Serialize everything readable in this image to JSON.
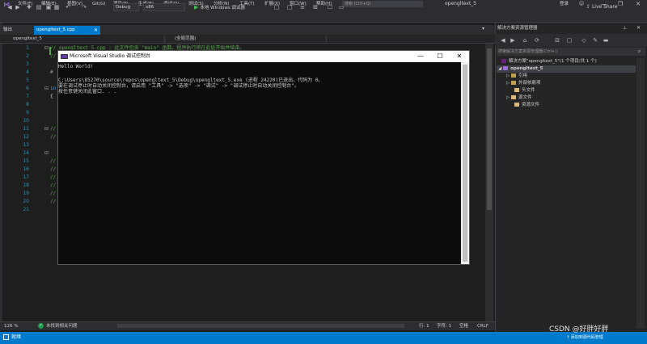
{
  "titlebar": {
    "menu": [
      "文件(F)",
      "编辑(E)",
      "视图(V)",
      "Git(G)",
      "项目(P)",
      "生成(B)",
      "调试(D)",
      "测试(S)",
      "分析(N)",
      "工具(T)",
      "扩展(X)",
      "窗口(W)",
      "帮助(H)"
    ],
    "search_placeholder": "搜索 (Ctrl+Q)",
    "window_title": "opengltext_5",
    "login": "登录",
    "minimize": "—",
    "restore": "❐",
    "close": "✕"
  },
  "toolbar": {
    "config": "Debug",
    "platform": "x86",
    "run_label": "本地 Windows 调试器",
    "liveshare": "Live Share"
  },
  "tabs": {
    "output": "输出",
    "file_tab": "opengltext_5.cpp",
    "file_tab_close": "✕"
  },
  "navbar": {
    "project": "opengltext_5",
    "scope": "(全局范围)"
  },
  "editor": {
    "line_numbers": [
      "1",
      "2",
      "3",
      "4",
      "5",
      "6",
      "7",
      "8",
      "9",
      "10",
      "11",
      "12",
      "13",
      "14",
      "15",
      "16",
      "17",
      "18",
      "19",
      "20",
      "21"
    ],
    "code_line1": "// opengltext_5.cpp : 此文件包含 \"main\" 函数。程序执行将在此处开始并结束。",
    "code_line2": "//",
    "code_line4": "#",
    "code_line6": "in",
    "code_line7": "{",
    "code_line11": "//",
    "code_line12": "//",
    "code_lines_14_20": [
      "//",
      "//",
      "//",
      "//",
      "//",
      "//",
      "//"
    ]
  },
  "editor_status": {
    "zoom": "126 %",
    "issues": "未找到相关问题",
    "line": "行: 1",
    "char": "字符: 1",
    "spaces": "空格",
    "eol": "CRLF"
  },
  "statusbar": {
    "ready": "就绪",
    "source_control": "添加到源代码管理"
  },
  "solution_explorer": {
    "title": "解决方案资源管理器",
    "search_placeholder": "搜索解决方案资源管理器(Ctrl+;)",
    "solution": "解决方案\"opengltext_5\"(1 个项目/共 1 个)",
    "project": "opengltext_5",
    "items": [
      "引用",
      "外部依赖项",
      "头文件",
      "源文件",
      "资源文件"
    ]
  },
  "console": {
    "title": "Microsoft Visual Studio 调试控制台",
    "lines": [
      "Hello World!",
      "",
      "C:\\Users\\85270\\source\\repos\\opengltext_5\\Debug\\opengltext_5.exe (进程 24220)已退出，代码为 0。",
      "要在调试停止时自动关闭控制台，请启用 \"工具\" -> \"选项\" -> \"调试\" -> \"调试停止时自动关闭控制台\"。",
      "按任意键关闭此窗口. . ."
    ]
  },
  "watermark": "CSDN @好胖好胖",
  "colors": {
    "accent": "#007acc",
    "background": "#1e1e1e",
    "comment": "#57a64a",
    "line_number": "#2b91af"
  }
}
